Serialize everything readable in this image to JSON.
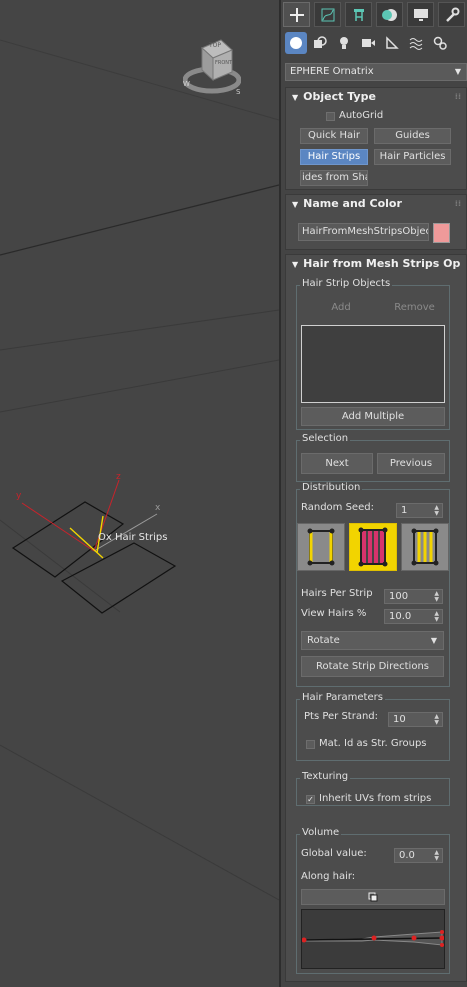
{
  "viewport": {
    "object_label": "Ox Hair Strips",
    "viewcube": {
      "top": "TOP",
      "front": "FRONT",
      "compass_w": "W",
      "compass_s": "S"
    },
    "axes": {
      "y": "y",
      "z": "z",
      "x": "x"
    }
  },
  "command_panel": {
    "tabs": [
      "create-tab",
      "modify-tab",
      "hierarchy-tab",
      "motion-tab",
      "display-tab",
      "utilities-tab"
    ],
    "subtabs": [
      "geometry",
      "shapes",
      "lights",
      "cameras",
      "helpers",
      "space-warps",
      "systems"
    ],
    "category": "EPHERE Ornatrix"
  },
  "object_type": {
    "title": "Object Type",
    "autogrid": "AutoGrid",
    "buttons": [
      "Quick Hair",
      "Guides",
      "Hair Strips",
      "Hair Particles",
      "ides from Shap"
    ],
    "selected": "Hair Strips"
  },
  "name_color": {
    "title": "Name and Color",
    "name_value": "HairFromMeshStripsObject",
    "color": "#ef9a9a"
  },
  "hair_from_mesh": {
    "title": "Hair from Mesh Strips Op",
    "strip_objects": {
      "title": "Hair Strip Objects",
      "add": "Add",
      "remove": "Remove",
      "add_multiple": "Add Multiple"
    },
    "selection": {
      "title": "Selection",
      "next": "Next",
      "previous": "Previous"
    },
    "distribution": {
      "title": "Distribution",
      "random_seed_label": "Random Seed:",
      "random_seed": "1",
      "hairs_per_strip_label": "Hairs Per Strip",
      "hairs_per_strip": "100",
      "view_hairs_label": "View Hairs %",
      "view_hairs": "10.0",
      "rotate_option": "Rotate",
      "rotate_button": "Rotate Strip Directions"
    },
    "hair_parameters": {
      "title": "Hair Parameters",
      "pts_label": "Pts Per Strand:",
      "pts_value": "10",
      "mat_id_label": "Mat. Id as Str. Groups"
    },
    "texturing": {
      "title": "Texturing",
      "inherit_label": "Inherit UVs from strips"
    },
    "volume": {
      "title": "Volume",
      "global_label": "Global value:",
      "global_value": "0.0",
      "along_label": "Along hair:"
    }
  }
}
